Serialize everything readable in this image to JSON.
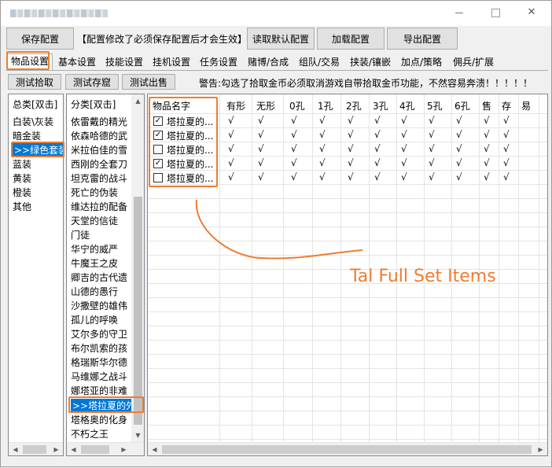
{
  "toolbar": {
    "save_label": "保存配置",
    "notice": "【配置修改了必须保存配置后才会生效】",
    "load_default_label": "读取默认配置",
    "load_label": "加载配置",
    "export_label": "导出配置"
  },
  "tabs": [
    "物品设置",
    "基本设置",
    "技能设置",
    "挂机设置",
    "任务设置",
    "赌博/合成",
    "组队/交易",
    "挟装/镶嵌",
    "加点/策略",
    "佣兵/扩展"
  ],
  "actions": {
    "test_pickup": "测试拾取",
    "test_stash": "测试存窟",
    "test_sell": "测试出售",
    "warning": "警告:勾选了拾取金币必须取消游戏自带拾取金币功能，不然容易奔溃！！！！！"
  },
  "category_list": {
    "header": "总类[双击]",
    "items": [
      "白装\\灰装",
      "暗金装",
      ">>绿色套装",
      "蓝装",
      "黄装",
      "橙装",
      "其他"
    ],
    "selected_index": 2
  },
  "subcategory_list": {
    "header": "分类[双击]",
    "items": [
      "依雷戴的精光",
      "依森哈德的武",
      "米拉伯佳的雪",
      "西刚的全套刀",
      "坦克雷的战斗",
      "死亡的伪装",
      "维达拉的配备",
      "天堂的信徒",
      "门徒",
      "华宁的威严",
      "牛魔王之皮",
      "卿吉的古代遗",
      "山德的愚行",
      "沙撒壁的雄伟",
      "孤儿的呼唤",
      "艾尔多的守卫",
      "布尔凯索的孩",
      "格瑞斯华尔德",
      "马维娜之战斗",
      "娜塔亚的非难",
      ">>塔拉夏的外",
      "塔格奥的化身",
      "不朽之王"
    ],
    "selected_index": 20
  },
  "grid": {
    "columns": [
      "物品名字",
      "有形",
      "无形",
      "0孔",
      "1孔",
      "2孔",
      "3孔",
      "4孔",
      "5孔",
      "6孔",
      "售",
      "存",
      "易"
    ],
    "mark": "√",
    "rows": [
      {
        "name": "塔拉夏的...",
        "checked": true,
        "marks": [
          true,
          true,
          true,
          true,
          true,
          true,
          true,
          true,
          true,
          true,
          true,
          false
        ]
      },
      {
        "name": "塔拉夏的...",
        "checked": true,
        "marks": [
          true,
          true,
          true,
          true,
          true,
          true,
          true,
          true,
          true,
          true,
          true,
          false
        ]
      },
      {
        "name": "塔拉夏的...",
        "checked": false,
        "marks": [
          true,
          true,
          true,
          true,
          true,
          true,
          true,
          true,
          true,
          true,
          true,
          false
        ]
      },
      {
        "name": "塔拉夏的...",
        "checked": true,
        "marks": [
          true,
          true,
          true,
          true,
          true,
          true,
          true,
          true,
          true,
          true,
          true,
          false
        ]
      },
      {
        "name": "塔拉夏的...",
        "checked": false,
        "marks": [
          true,
          true,
          true,
          true,
          true,
          true,
          true,
          true,
          true,
          true,
          true,
          false
        ]
      }
    ]
  },
  "annotation": {
    "text": "Tal Full Set Items",
    "color": "#ed7d31"
  },
  "colors": {
    "selection": "#0078d7",
    "highlight": "#ed7d31"
  },
  "icons": {
    "check": "✓",
    "arrow_left": "◀",
    "arrow_right": "▶",
    "arrow_up": "▲",
    "arrow_down": "▼"
  }
}
